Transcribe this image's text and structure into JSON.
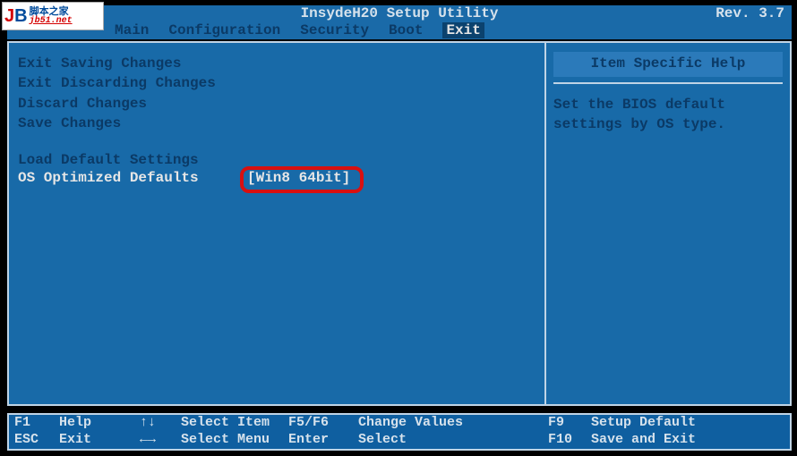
{
  "watermark": {
    "logo_j": "J",
    "logo_b": "B",
    "cn": "脚本之家",
    "url": "jb51.net"
  },
  "header": {
    "title": "InsydeH20 Setup Utility",
    "revision": "Rev. 3.7"
  },
  "tabs": [
    {
      "label": "Main"
    },
    {
      "label": "Configuration"
    },
    {
      "label": "Security"
    },
    {
      "label": "Boot"
    },
    {
      "label": "Exit",
      "active": true
    }
  ],
  "menu": {
    "items": [
      "Exit Saving Changes",
      "Exit Discarding Changes",
      "Discard Changes",
      "Save Changes"
    ],
    "load_defaults": "Load Default Settings",
    "selected": {
      "label": "OS Optimized Defaults",
      "value": "[Win8 64bit]"
    }
  },
  "help": {
    "title": "Item Specific Help",
    "body_line1": "Set the BIOS default",
    "body_line2": "settings by OS type."
  },
  "footer": {
    "row1": {
      "k1": "F1",
      "l1": "Help",
      "arrows": "↑↓",
      "sel": "Select Item",
      "mk": "F5/F6",
      "ml": "Change Values",
      "rk": "F9",
      "rl": "Setup Default"
    },
    "row2": {
      "k1": "ESC",
      "l1": "Exit",
      "arrows": "←→",
      "sel": "Select Menu",
      "mk": "Enter",
      "ml": "Select",
      "rk": "F10",
      "rl": "Save and Exit"
    }
  }
}
